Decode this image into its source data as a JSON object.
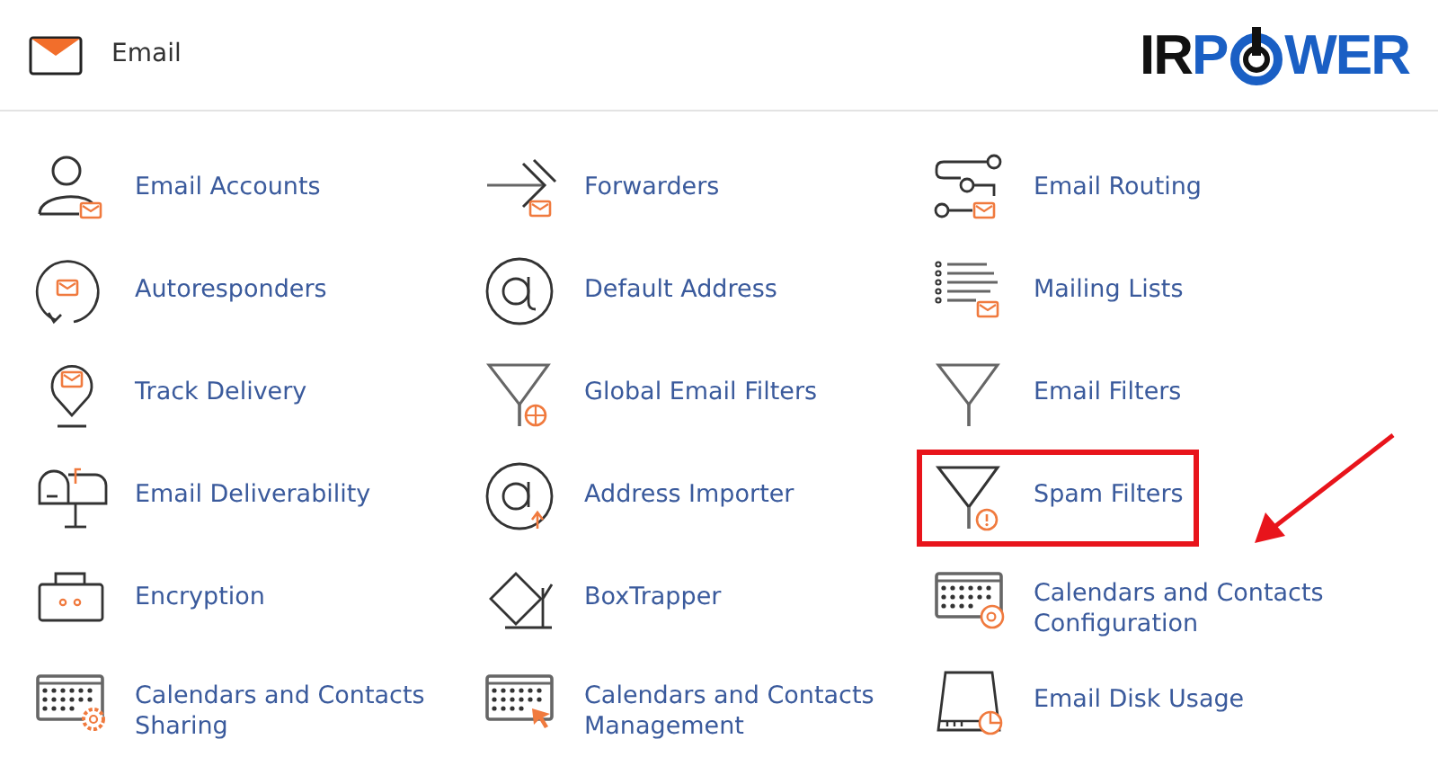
{
  "header": {
    "title": "Email",
    "logo": {
      "dark": "IR",
      "blue_left": "P",
      "blue_right": "WER"
    }
  },
  "items": [
    {
      "label": "Email Accounts",
      "kind": "user-mail",
      "highlighted": false
    },
    {
      "label": "Forwarders",
      "kind": "forward",
      "highlighted": false
    },
    {
      "label": "Email Routing",
      "kind": "routing",
      "highlighted": false
    },
    {
      "label": "Autoresponders",
      "kind": "autoresponder",
      "highlighted": false
    },
    {
      "label": "Default Address",
      "kind": "at",
      "highlighted": false
    },
    {
      "label": "Mailing Lists",
      "kind": "list",
      "highlighted": false
    },
    {
      "label": "Track Delivery",
      "kind": "pin",
      "highlighted": false
    },
    {
      "label": "Global Email Filters",
      "kind": "filter-globe",
      "highlighted": false
    },
    {
      "label": "Email Filters",
      "kind": "filter",
      "highlighted": false
    },
    {
      "label": "Email Deliverability",
      "kind": "mailbox",
      "highlighted": false
    },
    {
      "label": "Address Importer",
      "kind": "at-import",
      "highlighted": false
    },
    {
      "label": "Spam Filters",
      "kind": "filter-alert",
      "highlighted": true
    },
    {
      "label": "Encryption",
      "kind": "lock",
      "highlighted": false
    },
    {
      "label": "BoxTrapper",
      "kind": "boxtrap",
      "highlighted": false
    },
    {
      "label": "Calendars and Contacts Configuration",
      "kind": "calendar-at",
      "highlighted": false
    },
    {
      "label": "Calendars and Contacts Sharing",
      "kind": "calendar-gear",
      "highlighted": false
    },
    {
      "label": "Calendars and Contacts Management",
      "kind": "calendar-cursor",
      "highlighted": false
    },
    {
      "label": "Email Disk Usage",
      "kind": "disk",
      "highlighted": false
    }
  ]
}
